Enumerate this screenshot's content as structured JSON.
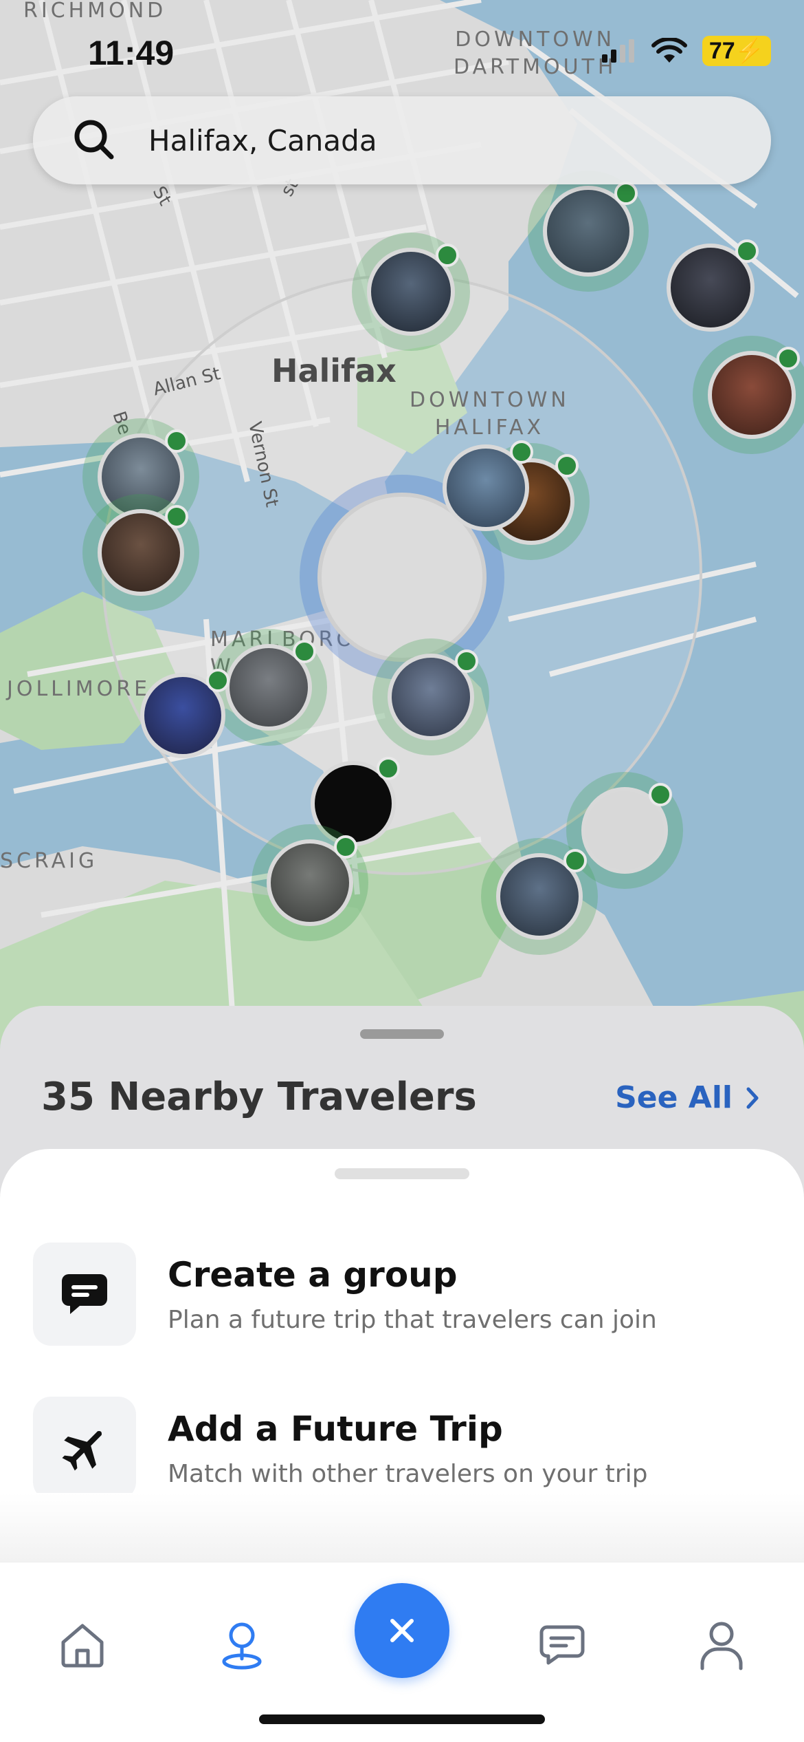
{
  "status_bar": {
    "time": "11:49",
    "battery": "77"
  },
  "search": {
    "value": "Halifax, Canada",
    "icon": "search-icon"
  },
  "map": {
    "labels": {
      "richmond": "RICHMOND",
      "downtown_dartmouth": "DOWNTOWN\nDARTMOUTH",
      "halifax": "Halifax",
      "downtown_halifax": "DOWNTOWN\nHALIFAX",
      "marlborough": "MARLBOROU\nWOODS",
      "jollimore": "JOLLIMORE",
      "scraig": "SCRAIG",
      "allan_st": "Allan St",
      "vernon_st": "Vernon St",
      "bel": "Be",
      "st1": "St",
      "st2": "st"
    }
  },
  "nearby": {
    "title": "35 Nearby Travelers",
    "see_all": "See All"
  },
  "sheet": {
    "options": [
      {
        "title": "Create a group",
        "subtitle": "Plan a future trip that travelers can join",
        "icon": "chat-bubble-icon"
      },
      {
        "title": "Add a Future Trip",
        "subtitle": "Match with other travelers on your trip",
        "icon": "airplane-icon"
      }
    ]
  },
  "tabbar": {
    "items": [
      "home-icon",
      "map-pin-icon",
      "close-icon",
      "message-icon",
      "profile-icon"
    ],
    "active": "map-pin-icon",
    "accent": "#2f7cf2"
  }
}
